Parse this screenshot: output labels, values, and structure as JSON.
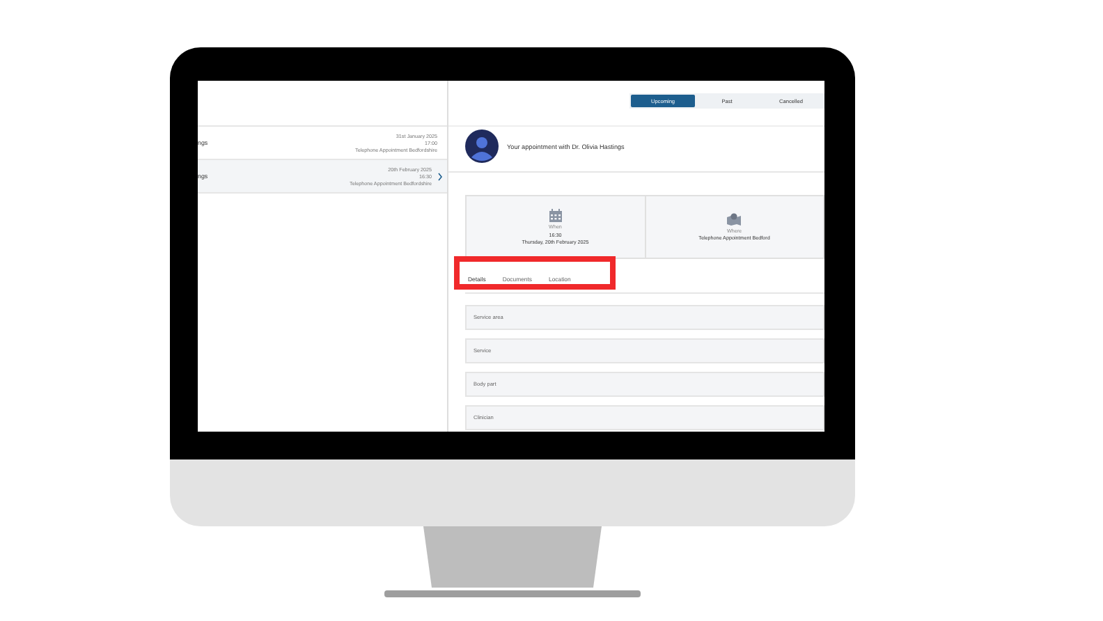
{
  "sidebar": {
    "items": [
      {
        "title": "ngs",
        "date": "31st January 2025",
        "time": "17:00",
        "location": "Telephone Appointment Bedfordshire",
        "selected": false
      },
      {
        "title": "ngs",
        "date": "20th February 2025",
        "time": "16:30",
        "location": "Telephone Appointment Bedfordshire",
        "selected": true
      }
    ]
  },
  "filter_tabs": [
    {
      "label": "Upcoming",
      "selected": true
    },
    {
      "label": "Past",
      "selected": false
    },
    {
      "label": "Cancelled",
      "selected": false
    }
  ],
  "header": {
    "title": "Your appointment with Dr. Olivia Hastings"
  },
  "info_cards": [
    {
      "kind": "calendar",
      "label": "When",
      "lines": [
        "16:30",
        "Thursday, 20th February 2025"
      ]
    },
    {
      "kind": "map",
      "label": "Where",
      "lines": [
        "Telephone Appointment Bedford"
      ]
    }
  ],
  "detail_tabs": [
    {
      "label": "Details",
      "selected": true
    },
    {
      "label": "Documents",
      "selected": false
    },
    {
      "label": "Location",
      "selected": false
    }
  ],
  "detail_rows": [
    "Service area",
    "Service",
    "Body part",
    "Clinician"
  ]
}
